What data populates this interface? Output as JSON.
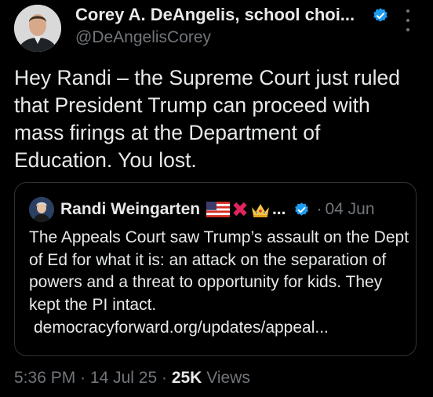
{
  "tweet": {
    "author_name": "Corey A. DeAngelis, school choi...",
    "author_handle": "@DeAngelisCorey",
    "body": "Hey Randi – the Supreme Court just ruled that President Trump can proceed with mass firings at the Department of Education. You lost."
  },
  "quote": {
    "author_name": "Randi Weingarten",
    "name_suffix": "...",
    "emoji_x": "✖",
    "separator": "·",
    "date": "04 Jun",
    "text": "The Appeals Court saw Trump’s assault on the Dept of Ed for what it is: an attack on the separation of powers and a threat to opportunity for kids. They kept the PI intact.",
    "link": "democracyforward.org/updates/appeal..."
  },
  "meta": {
    "time": "5:36 PM",
    "sep1": "·",
    "date": "14 Jul 25",
    "sep2": "·",
    "views_count": "25K",
    "views_label": "Views"
  },
  "colors": {
    "background": "#000000",
    "text_primary": "#e7e9ea",
    "text_secondary": "#71767b",
    "verified_badge": "#1d9bf0",
    "border": "#2f3336"
  },
  "icons": [
    "avatar",
    "verified-badge-icon",
    "more-options-icon",
    "us-flag-icon",
    "red-x-icon",
    "crown-icon"
  ]
}
